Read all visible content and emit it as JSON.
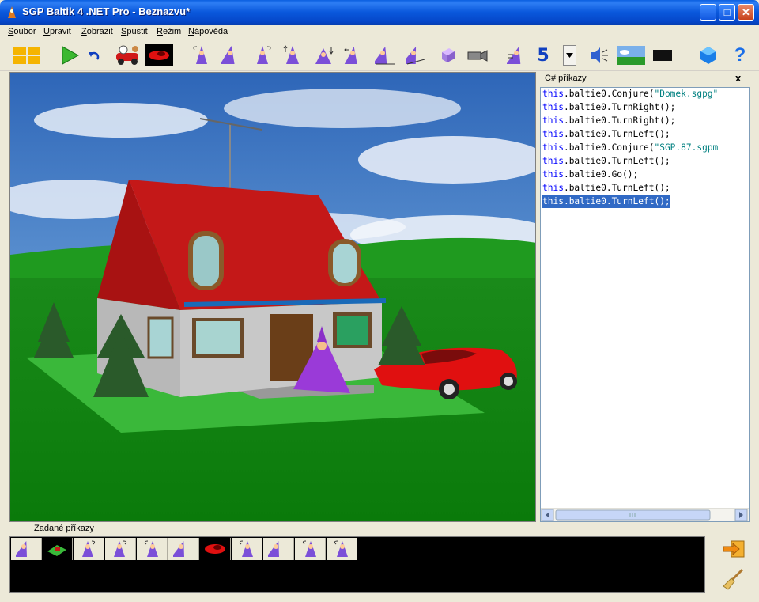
{
  "window": {
    "title": "SGP Baltik 4 .NET Pro - Beznazvu*",
    "minimize": "_",
    "maximize": "□",
    "close": "✕"
  },
  "menu": [
    {
      "accel": "S",
      "rest": "oubor"
    },
    {
      "accel": "U",
      "rest": "pravit"
    },
    {
      "accel": "Z",
      "rest": "obrazit"
    },
    {
      "accel": "S",
      "rest": "pustit"
    },
    {
      "accel": "R",
      "rest": "ežim"
    },
    {
      "accel": "N",
      "rest": "ápověda"
    }
  ],
  "toolbar": {
    "items": [
      "layout-icon",
      "run-icon",
      "undo-icon",
      "race-car-icon",
      "red-car-icon",
      "wizard-turn-left-icon",
      "wizard-go-icon",
      "wizard-turn-right-icon",
      "wizard-up-icon",
      "wizard-down-icon",
      "wizard-left-icon",
      "wizard-walk-icon",
      "wizard-run-icon",
      "cube-icon",
      "camera-icon",
      "wizard-speed-icon",
      "speed-dropdown",
      "sound-icon",
      "landscape-icon",
      "black-square-icon",
      "gem-icon",
      "help-icon"
    ],
    "speed_value": "5",
    "help_glyph": "?"
  },
  "panel": {
    "title": "C# příkazy",
    "close": "x",
    "lines": [
      {
        "kw": "this",
        "rest": ".baltie0.Conjure(",
        "str": "\"Domek.sgpg\"",
        "tail": ""
      },
      {
        "kw": "this",
        "rest": ".baltie0.TurnRight();",
        "str": "",
        "tail": ""
      },
      {
        "kw": "this",
        "rest": ".baltie0.TurnRight();",
        "str": "",
        "tail": ""
      },
      {
        "kw": "this",
        "rest": ".baltie0.TurnLeft();",
        "str": "",
        "tail": ""
      },
      {
        "kw": "this",
        "rest": ".baltie0.Conjure(",
        "str": "\"SGP.87.sgpm",
        "tail": ""
      },
      {
        "kw": "this",
        "rest": ".baltie0.TurnLeft();",
        "str": "",
        "tail": ""
      },
      {
        "kw": "this",
        "rest": ".baltie0.Go();",
        "str": "",
        "tail": ""
      },
      {
        "kw": "this",
        "rest": ".baltie0.TurnLeft();",
        "str": "",
        "tail": ""
      },
      {
        "kw": "this",
        "rest": ".baltie0.TurnLeft();",
        "str": "",
        "tail": ""
      }
    ],
    "selected_line": 9
  },
  "commands": {
    "label": "Zadané příkazy",
    "items": [
      "wizard-walk-icon",
      "house-plot-icon",
      "wizard-turn-right-icon",
      "wizard-turn-right-icon",
      "wizard-turn-left-icon",
      "wizard-walk-icon",
      "red-car-icon",
      "wizard-turn-left-icon",
      "wizard-walk-icon",
      "wizard-turn-left-icon",
      "wizard-turn-left-icon"
    ]
  },
  "colors": {
    "titlebar": "#0a58dc",
    "keyword": "#0000ff",
    "string": "#008080",
    "selection": "#316ac5"
  }
}
